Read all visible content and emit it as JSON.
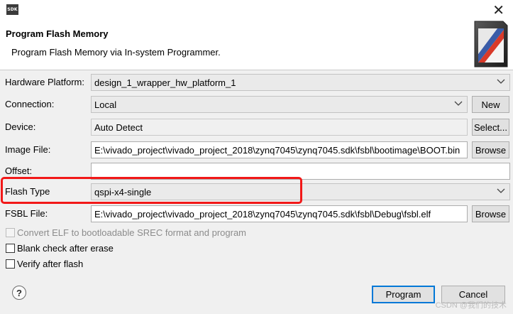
{
  "window": {
    "app_icon_text": "SDK",
    "close_glyph": "✕"
  },
  "header": {
    "title": "Program Flash Memory",
    "description": "Program Flash Memory via In-system Programmer.",
    "banner_icon": "flash-memory-banner-icon"
  },
  "form": {
    "hardware_platform": {
      "label": "Hardware Platform:",
      "value": "design_1_wrapper_hw_platform_1"
    },
    "connection": {
      "label": "Connection:",
      "value": "Local",
      "button": "New"
    },
    "device": {
      "label": "Device:",
      "value": "Auto Detect",
      "button": "Select..."
    },
    "image_file": {
      "label": "Image File:",
      "value": "E:\\vivado_project\\vivado_project_2018\\zynq7045\\zynq7045.sdk\\fsbl\\bootimage\\BOOT.bin",
      "button": "Browse"
    },
    "offset": {
      "label": "Offset:",
      "value": ""
    },
    "flash_type": {
      "label": "Flash Type",
      "value": "qspi-x4-single"
    },
    "fsbl_file": {
      "label": "FSBL File:",
      "value": "E:\\vivado_project\\vivado_project_2018\\zynq7045\\zynq7045.sdk\\fsbl\\Debug\\fsbl.elf",
      "button": "Browse"
    }
  },
  "options": {
    "convert_elf": {
      "label": "Convert ELF to bootloadable SREC format and program",
      "checked": false,
      "enabled": false
    },
    "blank_check": {
      "label": "Blank check after erase",
      "checked": false,
      "enabled": true
    },
    "verify": {
      "label": "Verify after flash",
      "checked": false,
      "enabled": true
    }
  },
  "footer": {
    "help_glyph": "?",
    "program_button": "Program",
    "cancel_button": "Cancel"
  },
  "watermark": "CSDN @我们的技术",
  "colors": {
    "highlight": "#f21818",
    "primary_button_border": "#0078d7"
  }
}
